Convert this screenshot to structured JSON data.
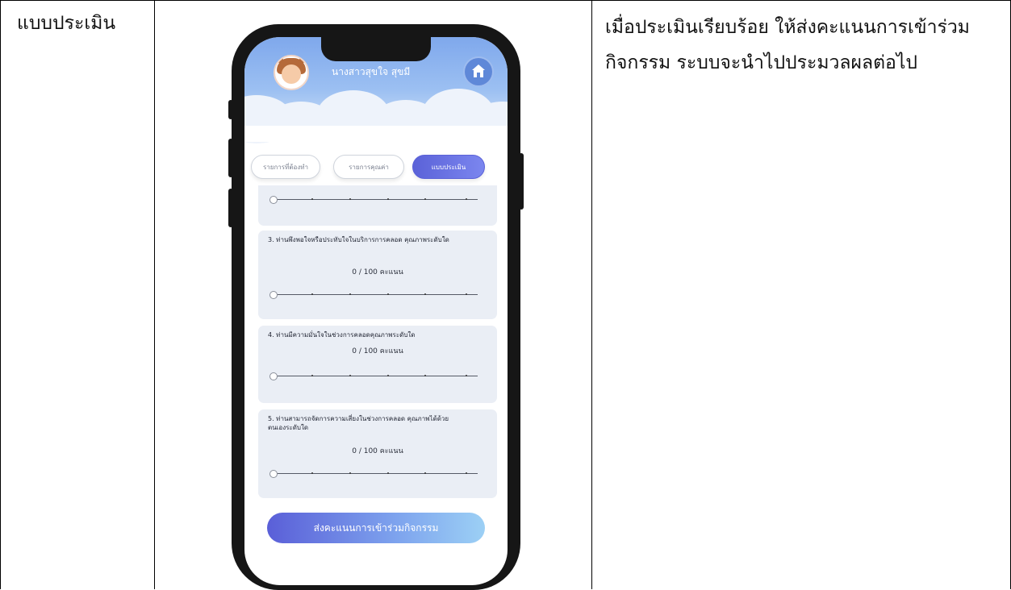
{
  "row_label": "แบบประเมิน",
  "description": "เมื่อประเมินเรียบร้อย ให้ส่งคะแนนการเข้าร่วมกิจกรรม ระบบจะนำไปประมวลผลต่อไป",
  "phone": {
    "user_name": "นางสาวสุขใจ สุขมี",
    "tabs": [
      {
        "label": "รายการที่ต้องทำ"
      },
      {
        "label": "รายการคุณค่า"
      },
      {
        "label": "แบบประเมิน"
      }
    ],
    "questions": [
      {
        "text": "3. ท่านพึงพอใจหรือประทับใจในบริการการคลอด คุณภาพระดับใด",
        "score": "0 / 100 คะแนน"
      },
      {
        "text": "4. ท่านมีความมั่นใจในช่วงการคลอดคุณภาพระดับใด",
        "score": "0 / 100 คะแนน"
      },
      {
        "text": "5. ท่านสามารถจัดการความเสี่ยงในช่วงการคลอด คุณภาพได้ด้วยตนเองระดับใด",
        "score": "0 / 100 คะแนน"
      }
    ],
    "slider_values": [
      0,
      0,
      0,
      0
    ],
    "submit_label": "ส่งคะแนนการเข้าร่วมกิจกรรม",
    "colors": {
      "header": "#7fa8ec",
      "active_tab": "#5b62d8",
      "card": "#eaeef5",
      "phone_frame": "#161616"
    }
  }
}
